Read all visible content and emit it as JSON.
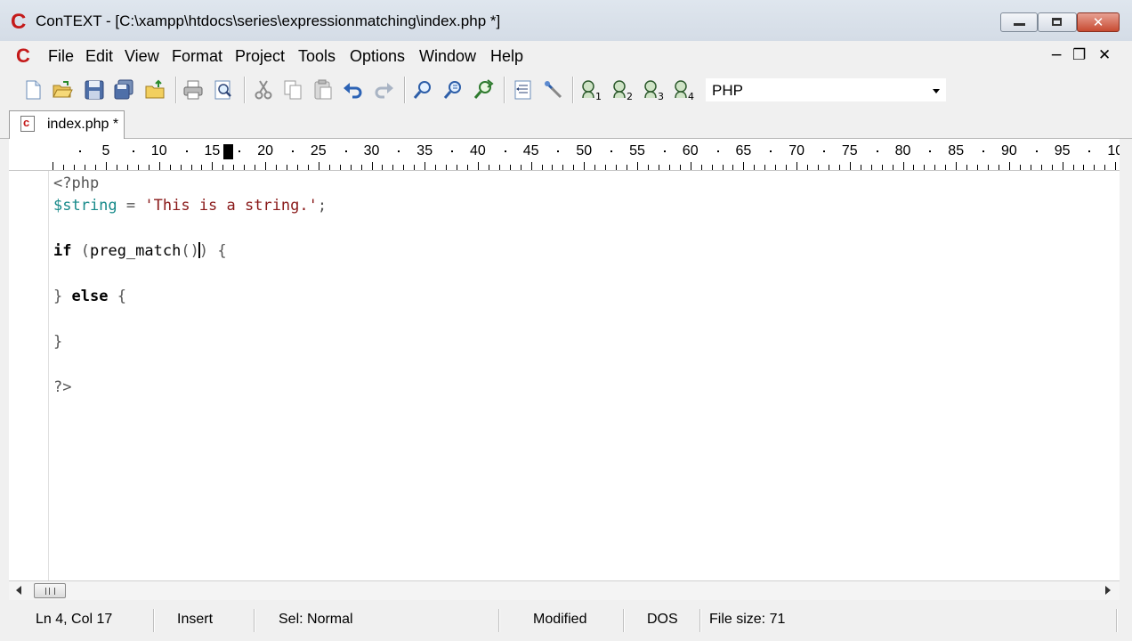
{
  "window": {
    "title": "ConTEXT - [C:\\xampp\\htdocs\\series\\expressionmatching\\index.php *]",
    "logo_letter": "C",
    "controls": {
      "minimize": "",
      "maximize": "",
      "close": "✕"
    }
  },
  "menu": {
    "items": [
      "File",
      "Edit",
      "View",
      "Format",
      "Project",
      "Tools",
      "Options",
      "Window",
      "Help"
    ],
    "mdi_controls": {
      "minimize": "−",
      "restore": "❐",
      "close": "✕"
    }
  },
  "toolbar": {
    "language": "PHP",
    "icons": [
      "new-file-icon",
      "open-folder-icon",
      "save-icon",
      "save-all-icon",
      "open-folder-up-icon",
      "print-icon",
      "print-preview-icon",
      "cut-icon",
      "copy-icon",
      "paste-icon",
      "undo-icon",
      "redo-icon",
      "find-icon",
      "find-next-icon",
      "replace-icon",
      "indent-icon",
      "macro-icon",
      "user-exec-1-icon",
      "user-exec-2-icon",
      "user-exec-3-icon",
      "user-exec-4-icon"
    ]
  },
  "tabs": [
    {
      "label": "index.php *",
      "icon_letter": "c",
      "active": true
    }
  ],
  "ruler": {
    "labels": [
      "5",
      "10",
      "15",
      "20",
      "25",
      "30",
      "35",
      "40",
      "45",
      "50",
      "55",
      "60",
      "65",
      "70",
      "75",
      "80",
      "85",
      "90",
      "95",
      "10"
    ]
  },
  "editor": {
    "lines": [
      "<?php",
      "$string = 'This is a string.';",
      "",
      "if (preg_match() {",
      "",
      "} else {",
      "",
      "}",
      "",
      "?>"
    ]
  },
  "status": {
    "position": "Ln 4, Col 17",
    "mode": "Insert",
    "selection": "Sel: Normal",
    "modified": "Modified",
    "line_endings": "DOS",
    "file_size": "File size: 71"
  }
}
